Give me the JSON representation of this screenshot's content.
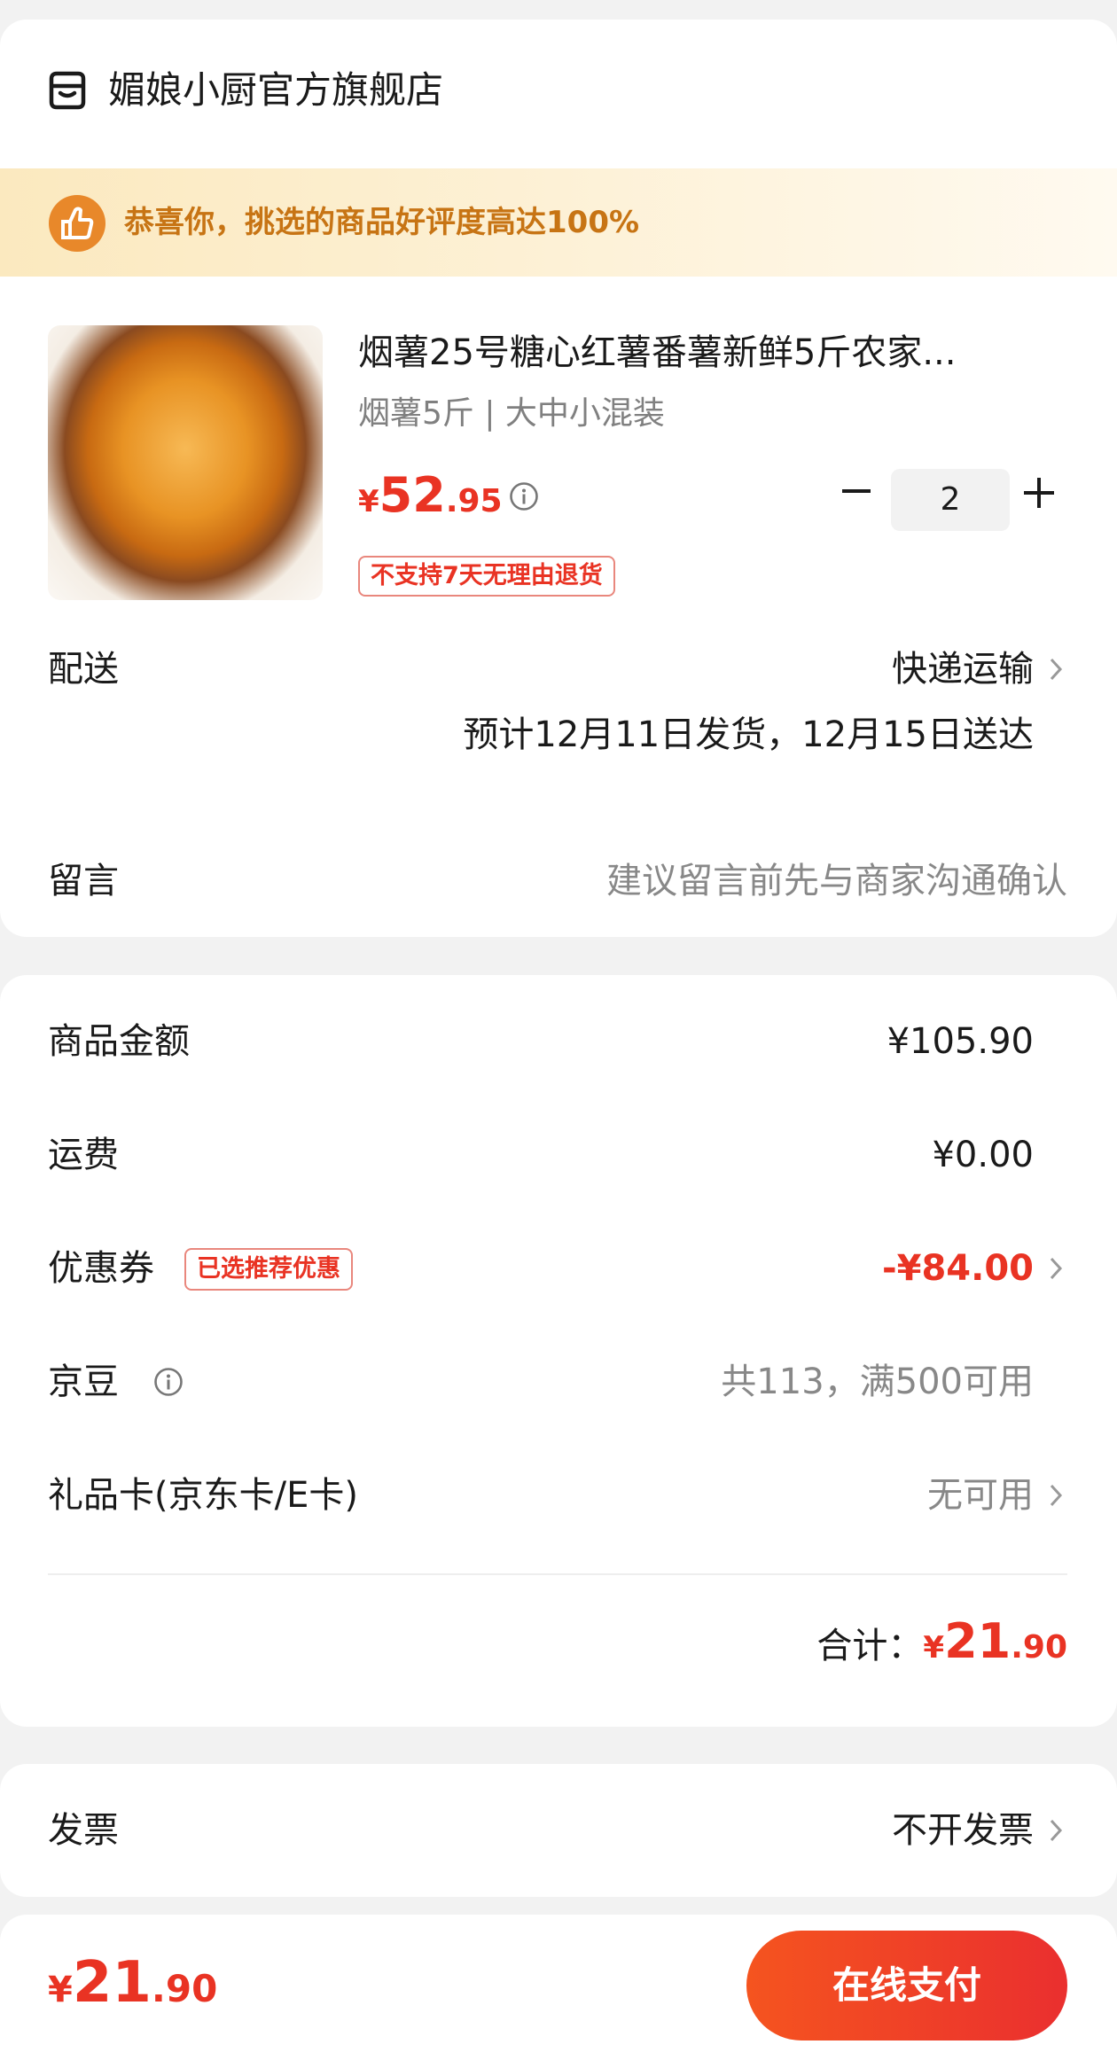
{
  "store": {
    "name": "媚娘小厨官方旗舰店",
    "icon": "store-icon"
  },
  "banner": {
    "text": "恭喜你，挑选的商品好评度高达100%",
    "icon": "thumbs-up-icon",
    "text_color": "#c77414",
    "icon_color": "#e8882a"
  },
  "product": {
    "title": "烟薯25号糖心红薯番薯新鲜5斤农家...",
    "spec": "烟薯5斤 | 大中小混装",
    "price_symbol": "¥",
    "price_integer": "52",
    "price_decimal": ".95",
    "quantity": "2",
    "return_policy": "不支持7天无理由退货"
  },
  "delivery": {
    "label": "配送",
    "method": "快递运输",
    "eta": "预计12月11日发货，12月15日送达"
  },
  "message": {
    "label": "留言",
    "placeholder": "建议留言前先与商家沟通确认"
  },
  "summary": {
    "goods_label": "商品金额",
    "goods_value": "¥105.90",
    "shipping_label": "运费",
    "shipping_value": "¥0.00",
    "coupon_label": "优惠券",
    "coupon_tag": "已选推荐优惠",
    "coupon_value": "-¥84.00",
    "jingdou_label": "京豆",
    "jingdou_value": "共113，满500可用",
    "giftcard_label": "礼品卡(京东卡/E卡)",
    "giftcard_value": "无可用",
    "total_label": "合计：",
    "total_symbol": "¥",
    "total_integer": "21",
    "total_decimal": ".90"
  },
  "invoice": {
    "label": "发票",
    "value": "不开发票"
  },
  "bottom": {
    "symbol": "¥",
    "integer": "21",
    "decimal": ".90",
    "pay_label": "在线支付"
  },
  "colors": {
    "accent_red": "#e93323",
    "pay_gradient_start": "#f5541f",
    "pay_gradient_end": "#ea2f2f"
  }
}
